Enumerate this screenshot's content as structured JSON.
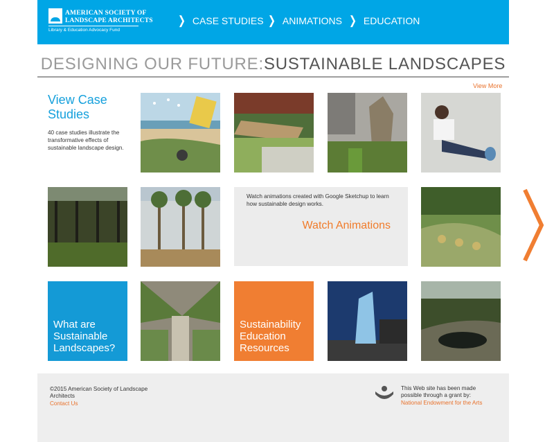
{
  "header": {
    "logo_line1": "AMERICAN SOCIETY OF",
    "logo_line2": "LANDSCAPE ARCHITECTS",
    "logo_sub": "Library & Education Advocacy Fund",
    "nav": [
      {
        "label": "CASE STUDIES",
        "icon": "chevron-right-icon"
      },
      {
        "label": "ANIMATIONS",
        "icon": "chevron-right-icon"
      },
      {
        "label": "EDUCATION",
        "icon": "chevron-right-icon"
      }
    ],
    "accent_color": "#00a6e6"
  },
  "title": {
    "part1": "DESIGNING OUR FUTURE:",
    "part2": "SUSTAINABLE LANDSCAPES"
  },
  "view_more": "View More",
  "case_studies": {
    "heading": "View Case Studies",
    "description": "40 case studies illustrate the transformative effects of sustainable landscape design."
  },
  "animations": {
    "description": "Watch animations created with Google Sketchup to learn how sustainable design works.",
    "link": "Watch Animations",
    "accent_color": "#f07b2a"
  },
  "tiles": {
    "what_are": "What are Sustainable Landscapes?",
    "education": "Sustainability Education Resources"
  },
  "footer": {
    "copyright": "©2015 American Society of Landscape Architects",
    "contact": "Contact Us",
    "grant": "This Web site has been made possible through a grant by:",
    "grant_link": "National Endowment for the Arts"
  }
}
